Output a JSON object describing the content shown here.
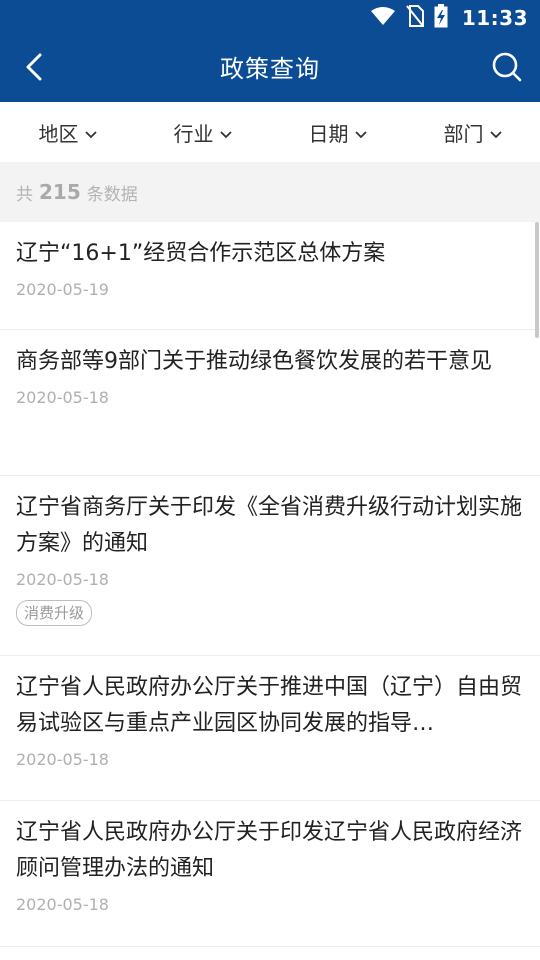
{
  "status_bar": {
    "time": "11:33",
    "icons": [
      "wifi-icon",
      "no-sim-icon",
      "battery-charging-icon"
    ]
  },
  "app_bar": {
    "title": "政策查询",
    "back_icon": "back-arrow-icon",
    "search_icon": "search-icon"
  },
  "filters": [
    {
      "label": "地区"
    },
    {
      "label": "行业"
    },
    {
      "label": "日期"
    },
    {
      "label": "部门"
    }
  ],
  "count": {
    "prefix": "共",
    "number": "215",
    "suffix": "条数据"
  },
  "items": [
    {
      "title": "辽宁“16+1”经贸合作示范区总体方案",
      "date": "2020-05-19"
    },
    {
      "title": "商务部等9部门关于推动绿色餐饮发展的若干意见",
      "date": "2020-05-18"
    },
    {
      "title": "辽宁省商务厅关于印发《全省消费升级行动计划实施方案》的通知",
      "date": "2020-05-18",
      "tag": "消费升级"
    },
    {
      "title": "辽宁省人民政府办公厅关于推进中国（辽宁）自由贸易试验区与重点产业园区协同发展的指导…",
      "date": "2020-05-18"
    },
    {
      "title": "辽宁省人民政府办公厅关于印发辽宁省人民政府经济顾问管理办法的通知",
      "date": "2020-05-18"
    }
  ],
  "colors": {
    "primary": "#0b4c95",
    "background_gray": "#f3f3f3",
    "date_gray": "#b0b0b0"
  }
}
